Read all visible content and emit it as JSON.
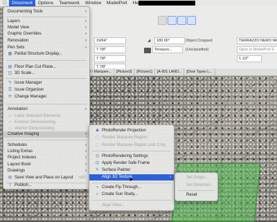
{
  "menubar": {
    "apple": "",
    "items": [
      "Document",
      "Options",
      "Teamwork",
      "Window",
      "ModelPort",
      "Help"
    ],
    "active_index": 0
  },
  "toolbar": {
    "field1": "19/64\"",
    "angle": "180.00°",
    "object_label": "Object Cropped",
    "material": "TERRAZZO NERO MACRO",
    "field2": "7 7/8\"",
    "terrazzo": "Terrazzo...",
    "unclassified": "(Unclassified)",
    "open_label": "Open in ModelPort E",
    "field3": "7 7/8\"",
    "field4": "7 7/8\"",
    "field5": "1 1/2\""
  },
  "tabs": [
    "[3D / Marquee...",
    "[Picture2]",
    "[Picture1]",
    "[A-901 LAND...",
    "[Door Types L..."
  ],
  "main_menu": {
    "items": [
      {
        "label": "Documenting Tools",
        "arrow": true
      },
      {
        "label": "Layers",
        "arrow": true
      },
      {
        "label": "Model View",
        "arrow": true
      },
      {
        "label": "Graphic Overrides",
        "arrow": true
      },
      {
        "label": "Renovation",
        "arrow": true
      },
      {
        "label": "Pen Sets",
        "arrow": true
      },
      {
        "label": "Partial Structure Display...",
        "icon": "partial-structure-icon"
      },
      {
        "label": "Floor Plan Cut Plane...",
        "icon": "floor-plan-icon"
      },
      {
        "label": "3D Scale...",
        "icon": "scale-icon"
      },
      {
        "label": "Issue Manager",
        "icon": "issue-icon"
      },
      {
        "label": "Issue Organizer",
        "icon": "organizer-icon"
      },
      {
        "label": "Change Manager",
        "icon": "change-icon"
      },
      {
        "label": "Annotation",
        "arrow": true
      },
      {
        "label": "Label Selected Elements",
        "disabled": true
      },
      {
        "label": "Exterior Dimensioning...",
        "disabled": true
      },
      {
        "label": "Interior Dimensioning...",
        "disabled": true
      },
      {
        "label": "Creative Imaging",
        "arrow": true,
        "highlighted": true
      },
      {
        "label": "Schedules",
        "arrow": true
      },
      {
        "label": "Listing Extras",
        "arrow": true
      },
      {
        "label": "Project Indexes",
        "arrow": true
      },
      {
        "label": "Layout Book",
        "arrow": true
      },
      {
        "label": "Drawings",
        "arrow": true
      },
      {
        "label": "Save View and Place on Layout",
        "shortcut": "⌥F7"
      },
      {
        "label": "Publish..."
      }
    ]
  },
  "creative_menu": {
    "items": [
      {
        "label": "PhotoRender Projection",
        "icon": "camera-icon"
      },
      {
        "label": "Render Marquee Region",
        "icon": "render-icon",
        "disabled": true
      },
      {
        "label": "Render Marquee Region and Crop",
        "icon": "crop-icon",
        "disabled": true
      },
      {
        "label": "PhotoRendering Settings",
        "icon": "settings-icon"
      },
      {
        "label": "Apply Render Safe Frame",
        "icon": "frame-icon"
      },
      {
        "label": "Surface Painter",
        "icon": "brush-icon"
      },
      {
        "label": "Align 3D Texture",
        "arrow": true,
        "selected": true
      },
      {
        "label": "Create Fly-Through...",
        "icon": "fly-icon"
      },
      {
        "label": "Create Sun Study...",
        "icon": "sun-icon"
      },
      {
        "label": "Align View...",
        "disabled": true
      }
    ]
  },
  "align_menu": {
    "items": [
      {
        "label": "Set Origin...",
        "disabled": true
      },
      {
        "label": "Set Direction...",
        "disabled": true
      },
      {
        "label": "Reset"
      }
    ]
  }
}
